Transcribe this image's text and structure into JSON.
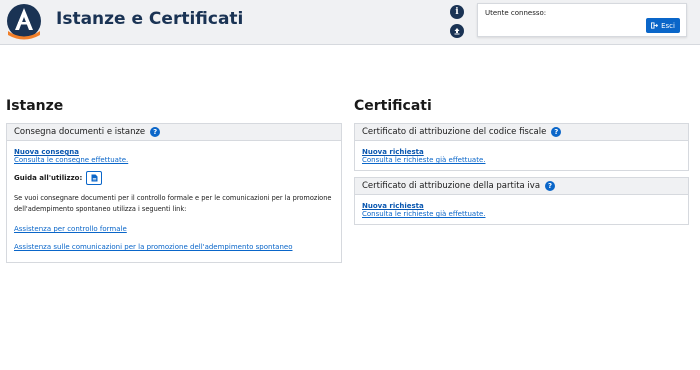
{
  "header": {
    "title": "Istanze e Certificati",
    "user_label": "Utente connesso:",
    "exit_label": "Esci",
    "info_icon": "info-icon",
    "upload_icon": "upload-icon"
  },
  "istanze": {
    "section_title": "Istanze",
    "card": {
      "title": "Consegna documenti e istanze",
      "new_link": "Nuova consegna",
      "view_link": "Consulta le consegne effettuate.",
      "guide_label": "Guida all'utilizzo:",
      "paragraph": "Se vuoi consegnare documenti per il controllo formale e per le comunicazioni per la promozione dell'adempimento spontaneo utilizza i seguenti link:",
      "link_formal": "Assistenza per controllo formale",
      "link_compliance": "Assistenza sulle comunicazioni per la promozione dell'adempimento spontaneo"
    }
  },
  "certificati": {
    "section_title": "Certificati",
    "cards": [
      {
        "title": "Certificato di attribuzione del codice fiscale",
        "new_link": "Nuova richiesta",
        "view_link": "Consulta le richieste già effettuate."
      },
      {
        "title": "Certificato di attribuzione della partita iva",
        "new_link": "Nuova richiesta",
        "view_link": "Consulta le richieste già effettuate."
      }
    ]
  },
  "colors": {
    "accent": "#0a66c9",
    "brand_dark": "#1a3354",
    "logo_orange": "#f07f2a",
    "header_bg": "#f0f1f3"
  }
}
